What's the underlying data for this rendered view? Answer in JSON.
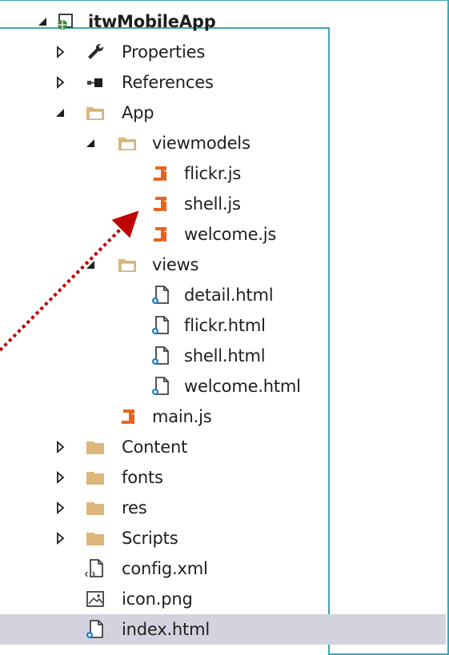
{
  "tree": {
    "rows": [
      {
        "label": "itwMobileApp",
        "bold": true,
        "depth": 0,
        "arrow": "expanded",
        "icon": "web-project-icon"
      },
      {
        "label": "Properties",
        "depth": 1,
        "arrow": "collapsed",
        "icon": "wrench-icon"
      },
      {
        "label": "References",
        "depth": 1,
        "arrow": "collapsed",
        "icon": "references-icon"
      },
      {
        "label": "App",
        "depth": 1,
        "arrow": "expanded",
        "icon": "folder-open-icon"
      },
      {
        "label": "viewmodels",
        "depth": 2,
        "arrow": "expanded",
        "icon": "folder-open-icon"
      },
      {
        "label": "flickr.js",
        "depth": 3,
        "arrow": "none",
        "icon": "js-file-icon"
      },
      {
        "label": "shell.js",
        "depth": 3,
        "arrow": "none",
        "icon": "js-file-icon"
      },
      {
        "label": "welcome.js",
        "depth": 3,
        "arrow": "none",
        "icon": "js-file-icon"
      },
      {
        "label": "views",
        "depth": 2,
        "arrow": "expanded",
        "icon": "folder-open-icon"
      },
      {
        "label": "detail.html",
        "depth": 3,
        "arrow": "none",
        "icon": "html-file-icon"
      },
      {
        "label": "flickr.html",
        "depth": 3,
        "arrow": "none",
        "icon": "html-file-icon"
      },
      {
        "label": "shell.html",
        "depth": 3,
        "arrow": "none",
        "icon": "html-file-icon"
      },
      {
        "label": "welcome.html",
        "depth": 3,
        "arrow": "none",
        "icon": "html-file-icon"
      },
      {
        "label": "main.js",
        "depth": 2,
        "arrow": "none",
        "icon": "js-file-icon"
      },
      {
        "label": "Content",
        "depth": 1,
        "arrow": "collapsed",
        "icon": "folder-closed-icon"
      },
      {
        "label": "fonts",
        "depth": 1,
        "arrow": "collapsed",
        "icon": "folder-closed-icon"
      },
      {
        "label": "res",
        "depth": 1,
        "arrow": "collapsed",
        "icon": "folder-closed-icon"
      },
      {
        "label": "Scripts",
        "depth": 1,
        "arrow": "collapsed",
        "icon": "folder-closed-icon"
      },
      {
        "label": "config.xml",
        "depth": 1,
        "arrow": "none",
        "icon": "xml-file-icon"
      },
      {
        "label": "icon.png",
        "depth": 1,
        "arrow": "none",
        "icon": "image-file-icon"
      },
      {
        "label": "index.html",
        "depth": 1,
        "arrow": "none",
        "icon": "html-file-icon",
        "selected": true
      }
    ]
  },
  "colors": {
    "frame": "#3fa7b3",
    "arrow_annotation": "#c00000",
    "js_icon": "#e8641e",
    "folder": "#dcb67a",
    "selection": "#d3d3df"
  }
}
